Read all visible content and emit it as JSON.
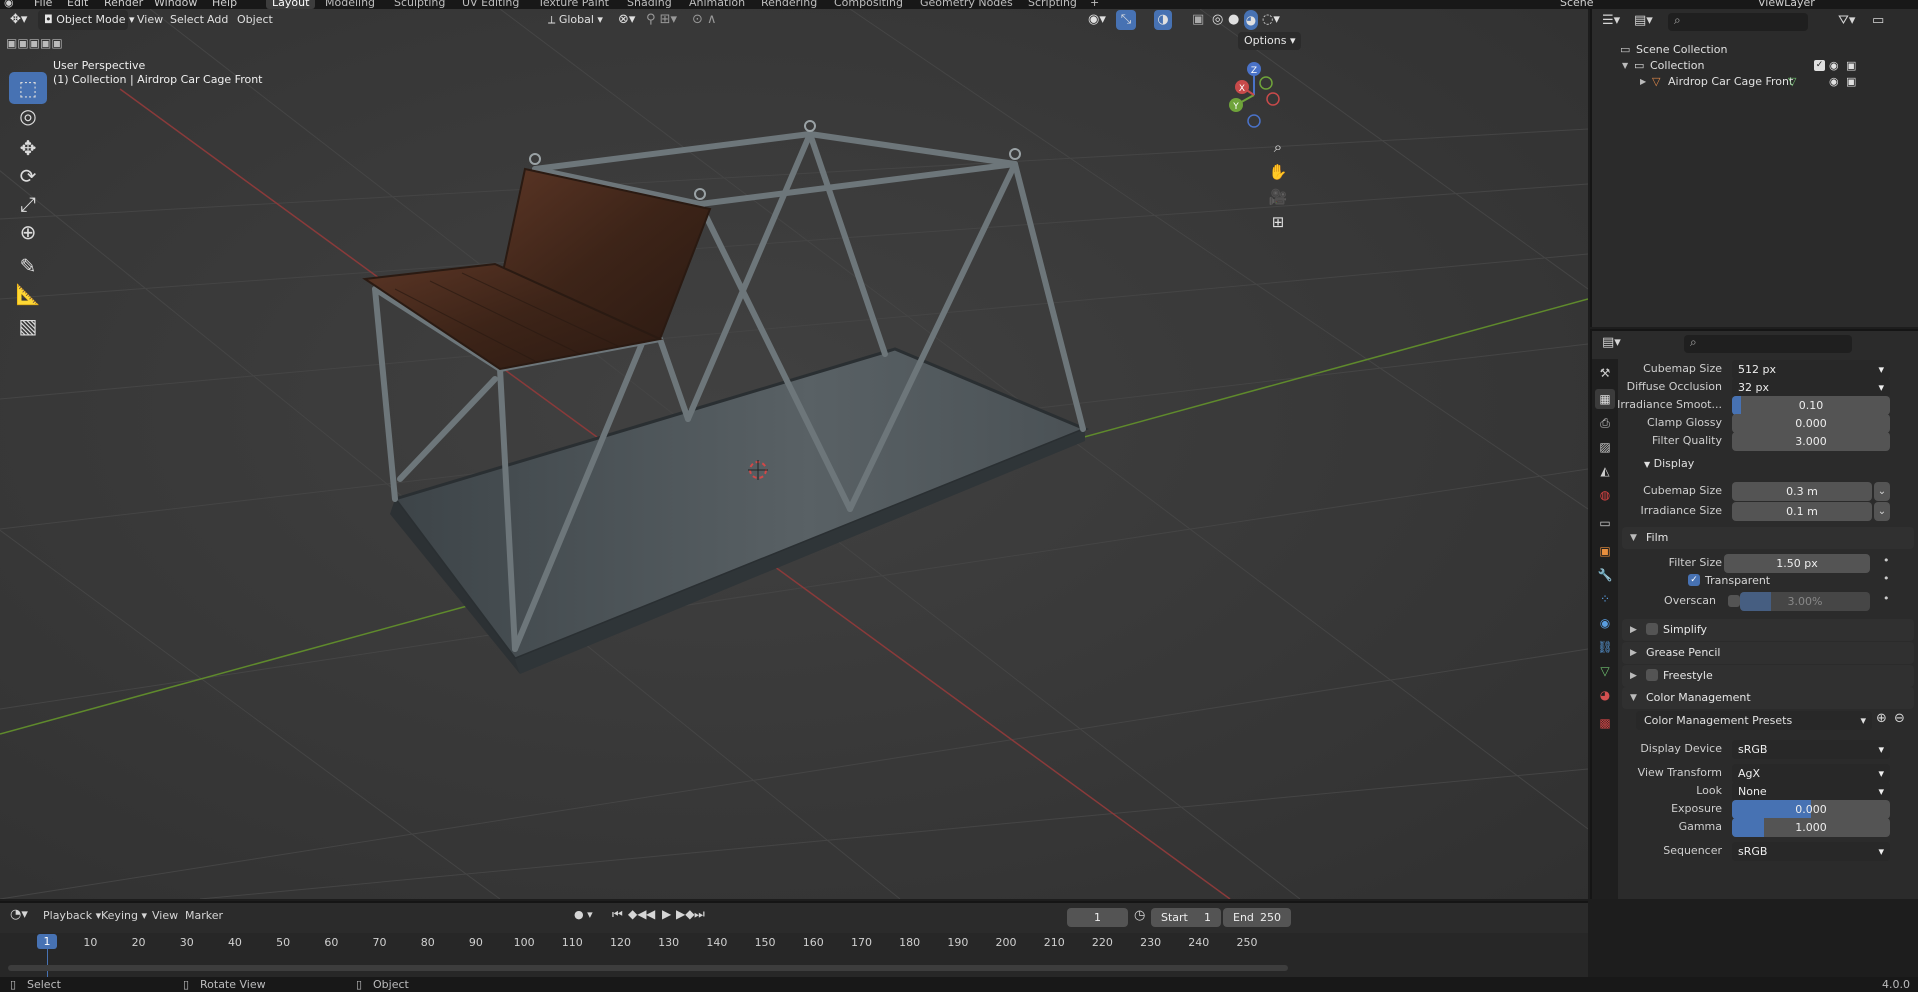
{
  "menu": {
    "items": [
      "File",
      "Edit",
      "Render",
      "Window",
      "Help"
    ],
    "workspaces": [
      "Layout",
      "Modeling",
      "Sculpting",
      "UV Editing",
      "Texture Paint",
      "Shading",
      "Animation",
      "Rendering",
      "Compositing",
      "Geometry Nodes",
      "Scripting"
    ],
    "active_workspace": "Layout",
    "add_workspace": "+",
    "scene": "Scene",
    "view_layer": "ViewLayer"
  },
  "viewport": {
    "mode": "Object Mode",
    "menus": [
      "View",
      "Select",
      "Add",
      "Object"
    ],
    "orientation": "Global",
    "options_label": "Options",
    "perspective": "User Perspective",
    "context": "(1) Collection | Airdrop Car Cage Front",
    "gizmo": {
      "x": "X",
      "y": "Y",
      "z": "Z"
    },
    "colors": {
      "bg": "#3a3a3a",
      "accent": "#4772b3",
      "x_axis": "#b34a4a",
      "y_axis": "#7aa33a"
    }
  },
  "tools": [
    "select-box",
    "cursor",
    "move",
    "rotate",
    "scale",
    "transform",
    "annotate",
    "measure",
    "add-cube"
  ],
  "outliner": {
    "scene_collection": "Scene Collection",
    "collection": "Collection",
    "object": "Airdrop Car Cage Front"
  },
  "properties": {
    "rows_top": [
      {
        "label": "Cubemap Size",
        "value": "512 px",
        "kind": "select"
      },
      {
        "label": "Diffuse Occlusion",
        "value": "32 px",
        "kind": "select"
      },
      {
        "label": "Irradiance Smoot...",
        "value": "0.10",
        "kind": "slider",
        "fill": 0.06
      },
      {
        "label": "Clamp Glossy",
        "value": "0.000",
        "kind": "number"
      },
      {
        "label": "Filter Quality",
        "value": "3.000",
        "kind": "number"
      }
    ],
    "display_section": "Display",
    "display_rows": [
      {
        "label": "Cubemap Size",
        "value": "0.3 m"
      },
      {
        "label": "Irradiance Size",
        "value": "0.1 m"
      }
    ],
    "film_section": "Film",
    "film_filter_label": "Filter Size",
    "film_filter_value": "1.50 px",
    "transparent_label": "Transparent",
    "overscan_label": "Overscan",
    "overscan_value": "3.00%",
    "collapsed_sections": [
      "Simplify",
      "Grease Pencil",
      "Freestyle"
    ],
    "color_management_section": "Color Management",
    "cm_presets": "Color Management Presets",
    "cm_rows": [
      {
        "label": "Display Device",
        "value": "sRGB",
        "kind": "select"
      },
      {
        "label": "View Transform",
        "value": "AgX",
        "kind": "select"
      },
      {
        "label": "Look",
        "value": "None",
        "kind": "select"
      },
      {
        "label": "Exposure",
        "value": "0.000",
        "kind": "slider",
        "fill": 0.5
      },
      {
        "label": "Gamma",
        "value": "1.000",
        "kind": "slider",
        "fill": 0.2
      },
      {
        "label": "Sequencer",
        "value": "sRGB",
        "kind": "select"
      }
    ]
  },
  "timeline": {
    "menus": [
      "Playback",
      "Keying",
      "View",
      "Marker"
    ],
    "current_frame": "1",
    "start_label": "Start",
    "start_value": "1",
    "end_label": "End",
    "end_value": "250",
    "ruler": [
      "1",
      "10",
      "20",
      "30",
      "40",
      "50",
      "60",
      "70",
      "80",
      "90",
      "100",
      "110",
      "120",
      "130",
      "140",
      "150",
      "160",
      "170",
      "180",
      "190",
      "200",
      "210",
      "220",
      "230",
      "240",
      "250"
    ]
  },
  "status": {
    "select": "Select",
    "rotate": "Rotate View",
    "object": "Object",
    "version": "4.0.0"
  }
}
